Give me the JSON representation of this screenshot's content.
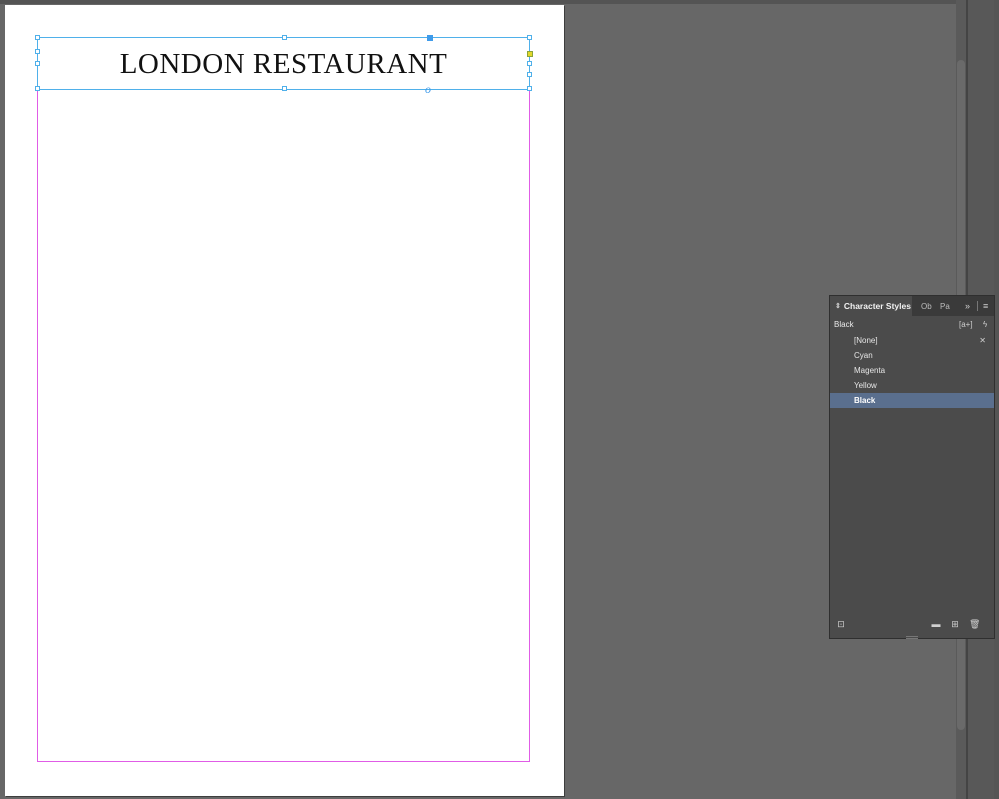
{
  "document": {
    "frame_text": "LONDON RESTAURANT"
  },
  "panel": {
    "tabs": [
      {
        "label": "Character Styles",
        "active": true
      },
      {
        "label": "Ob",
        "active": false
      },
      {
        "label": "Pa",
        "active": false
      }
    ],
    "current_style": "Black",
    "styles": [
      "[None]",
      "Cyan",
      "Magenta",
      "Yellow",
      "Black"
    ],
    "selected_style": "Black",
    "icons": {
      "collapse": "updown-arrow-icon",
      "expand": "double-chevron-icon",
      "menu": "panel-menu-icon",
      "new_from_selection": "a-plus-icon",
      "quick_apply": "lightning-icon",
      "edit_style": "wand-icon",
      "load_styles": "load-styles-icon",
      "new_group": "folder-icon",
      "new_style": "new-style-icon",
      "delete": "trash-icon"
    }
  },
  "colors": {
    "pasteboard": "#676767",
    "frame_stroke": "#4fb0ea",
    "margin_guide": "#e05ce6",
    "selection": "#5a6f8e"
  }
}
